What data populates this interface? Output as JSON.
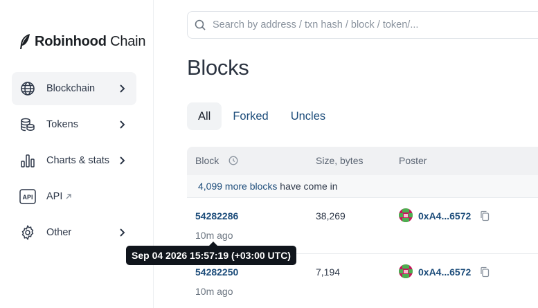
{
  "brand": {
    "name_bold": "Robinhood",
    "name_light": "Chain"
  },
  "sidebar": {
    "items": [
      {
        "label": "Blockchain",
        "icon": "globe-icon",
        "active": true
      },
      {
        "label": "Tokens",
        "icon": "coin-stack-icon"
      },
      {
        "label": "Charts & stats",
        "icon": "bar-chart-icon"
      },
      {
        "label": "API",
        "icon": "api-icon",
        "external": true
      },
      {
        "label": "Other",
        "icon": "gear-icon"
      }
    ]
  },
  "search": {
    "placeholder": "Search by address / txn hash / block / token/..."
  },
  "page": {
    "title": "Blocks"
  },
  "tabs": [
    {
      "label": "All",
      "active": true
    },
    {
      "label": "Forked"
    },
    {
      "label": "Uncles"
    }
  ],
  "table": {
    "columns": [
      "Block",
      "Size, bytes",
      "Poster"
    ],
    "notice": {
      "count": "4,099 more blocks",
      "rest": " have come in"
    },
    "rows": [
      {
        "block": "54282286",
        "age": "10m ago",
        "size": "38,269",
        "poster": "0xA4...6572"
      },
      {
        "block": "54282250",
        "age": "10m ago",
        "size": "7,194",
        "poster": "0xA4...6572"
      }
    ]
  },
  "tooltip": {
    "text": "Sep 04 2026 15:57:19 (+03:00 UTC)"
  },
  "colors": {
    "link": "#1c4c7a",
    "active_bg": "#f3f4f6",
    "header_bg": "#f0f1f3",
    "tooltip_bg": "#10151c"
  }
}
